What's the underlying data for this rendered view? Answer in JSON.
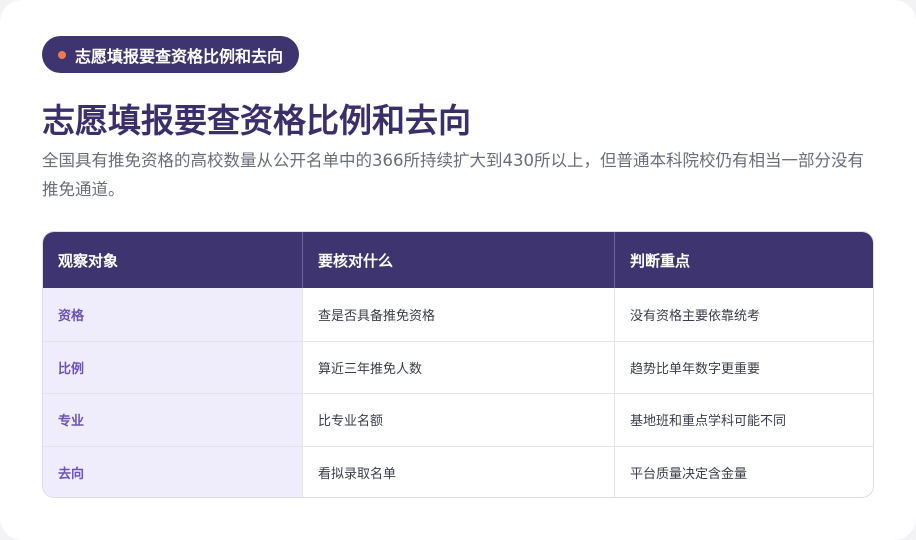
{
  "tag": {
    "label": "志愿填报要查资格比例和去向"
  },
  "title": "志愿填报要查资格比例和去向",
  "description": "全国具有推免资格的高校数量从公开名单中的366所持续扩大到430所以上，但普通本科院校仍有相当一部分没有推免通道。",
  "table": {
    "headers": [
      "观察对象",
      "要核对什么",
      "判断重点"
    ],
    "rows": [
      [
        "资格",
        "查是否具备推免资格",
        "没有资格主要依靠统考"
      ],
      [
        "比例",
        "算近三年推免人数",
        "趋势比单年数字更重要"
      ],
      [
        "专业",
        "比专业名额",
        "基地班和重点学科可能不同"
      ],
      [
        "去向",
        "看拟录取名单",
        "平台质量决定含金量"
      ]
    ]
  },
  "colors": {
    "primary": "#3e3470",
    "accent_dot": "#ee7a52",
    "key_cell_bg": "#efecfb",
    "key_cell_text": "#6b52b8"
  }
}
